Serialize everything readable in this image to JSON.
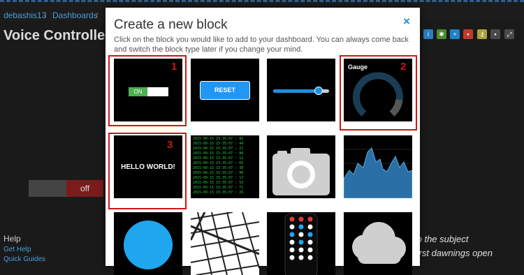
{
  "breadcrumb": {
    "user": "debashis13",
    "separator": "/",
    "dashboards": "Dashboards",
    "separator2": "/"
  },
  "page": {
    "title": "Voice Controlled"
  },
  "background_toggle": {
    "off_label": "off"
  },
  "help": {
    "heading": "Help",
    "get_help": "Get Help",
    "quick_guides": "Quick Guides"
  },
  "quote": {
    "line1": "to the subject",
    "line2": "first dawnings open"
  },
  "modal": {
    "title": "Create a new block",
    "close_icon": "×",
    "description": "Click on the block you would like to add to your dashboard. You can always come back and switch the block type later if you change your mind."
  },
  "tiles": {
    "toggle": {
      "on_label": "ON"
    },
    "button": {
      "label": "RESET"
    },
    "gauge": {
      "label": "Gauge"
    },
    "text": {
      "label": "HELLO WORLD!"
    },
    "stream": {
      "lines": [
        "2015-09-15 15:35:07 : 92",
        "2015-09-15 15:35:07 : 44",
        "2015-09-15 15:35:07 : 21",
        "2015-09-15 15:35:07 : 80",
        "2015-09-15 15:35:07 : 12",
        "2015-09-15 15:35:07 : 65",
        "2015-09-15 15:35:07 : 38",
        "2015-09-15 15:35:07 : 90",
        "2015-09-15 15:35:07 : 17",
        "2015-09-15 15:35:07 : 53",
        "2015-09-15 15:35:07 : 71",
        "2015-09-15 15:35:07 : 26"
      ]
    }
  },
  "annotations": {
    "a1": "1",
    "a2": "2",
    "a3": "3"
  },
  "colors": {
    "accent": "#1d8fd8",
    "toggle_on": "#4caf50",
    "button": "#2196f3",
    "highlight": "#d01414",
    "stream_text": "#2ecc40",
    "chart_fill": "#2a6fa5"
  },
  "toolbar_icons": [
    "info-icon",
    "gear-icon",
    "plus-icon",
    "trash-icon",
    "key-icon",
    "lock-icon",
    "expand-icon"
  ]
}
